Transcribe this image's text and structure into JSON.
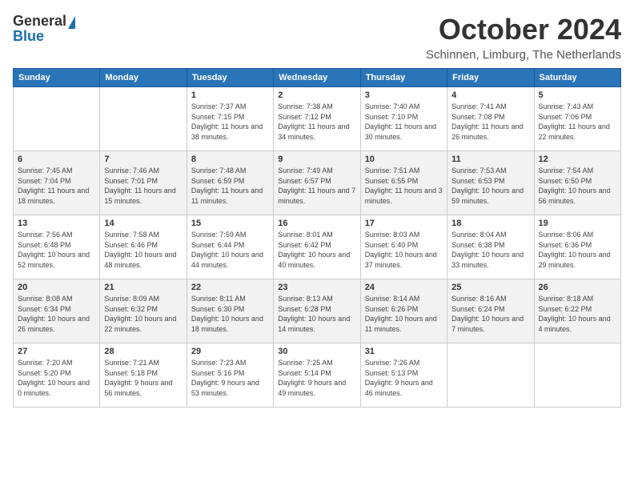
{
  "header": {
    "logo_general": "General",
    "logo_blue": "Blue",
    "month_title": "October 2024",
    "location": "Schinnen, Limburg, The Netherlands"
  },
  "days_of_week": [
    "Sunday",
    "Monday",
    "Tuesday",
    "Wednesday",
    "Thursday",
    "Friday",
    "Saturday"
  ],
  "weeks": [
    {
      "shaded": false,
      "days": [
        {
          "num": "",
          "info": ""
        },
        {
          "num": "",
          "info": ""
        },
        {
          "num": "1",
          "info": "Sunrise: 7:37 AM\nSunset: 7:15 PM\nDaylight: 11 hours and 38 minutes."
        },
        {
          "num": "2",
          "info": "Sunrise: 7:38 AM\nSunset: 7:12 PM\nDaylight: 11 hours and 34 minutes."
        },
        {
          "num": "3",
          "info": "Sunrise: 7:40 AM\nSunset: 7:10 PM\nDaylight: 11 hours and 30 minutes."
        },
        {
          "num": "4",
          "info": "Sunrise: 7:41 AM\nSunset: 7:08 PM\nDaylight: 11 hours and 26 minutes."
        },
        {
          "num": "5",
          "info": "Sunrise: 7:43 AM\nSunset: 7:06 PM\nDaylight: 11 hours and 22 minutes."
        }
      ]
    },
    {
      "shaded": true,
      "days": [
        {
          "num": "6",
          "info": "Sunrise: 7:45 AM\nSunset: 7:04 PM\nDaylight: 11 hours and 18 minutes."
        },
        {
          "num": "7",
          "info": "Sunrise: 7:46 AM\nSunset: 7:01 PM\nDaylight: 11 hours and 15 minutes."
        },
        {
          "num": "8",
          "info": "Sunrise: 7:48 AM\nSunset: 6:59 PM\nDaylight: 11 hours and 11 minutes."
        },
        {
          "num": "9",
          "info": "Sunrise: 7:49 AM\nSunset: 6:57 PM\nDaylight: 11 hours and 7 minutes."
        },
        {
          "num": "10",
          "info": "Sunrise: 7:51 AM\nSunset: 6:55 PM\nDaylight: 11 hours and 3 minutes."
        },
        {
          "num": "11",
          "info": "Sunrise: 7:53 AM\nSunset: 6:53 PM\nDaylight: 10 hours and 59 minutes."
        },
        {
          "num": "12",
          "info": "Sunrise: 7:54 AM\nSunset: 6:50 PM\nDaylight: 10 hours and 56 minutes."
        }
      ]
    },
    {
      "shaded": false,
      "days": [
        {
          "num": "13",
          "info": "Sunrise: 7:56 AM\nSunset: 6:48 PM\nDaylight: 10 hours and 52 minutes."
        },
        {
          "num": "14",
          "info": "Sunrise: 7:58 AM\nSunset: 6:46 PM\nDaylight: 10 hours and 48 minutes."
        },
        {
          "num": "15",
          "info": "Sunrise: 7:59 AM\nSunset: 6:44 PM\nDaylight: 10 hours and 44 minutes."
        },
        {
          "num": "16",
          "info": "Sunrise: 8:01 AM\nSunset: 6:42 PM\nDaylight: 10 hours and 40 minutes."
        },
        {
          "num": "17",
          "info": "Sunrise: 8:03 AM\nSunset: 6:40 PM\nDaylight: 10 hours and 37 minutes."
        },
        {
          "num": "18",
          "info": "Sunrise: 8:04 AM\nSunset: 6:38 PM\nDaylight: 10 hours and 33 minutes."
        },
        {
          "num": "19",
          "info": "Sunrise: 8:06 AM\nSunset: 6:36 PM\nDaylight: 10 hours and 29 minutes."
        }
      ]
    },
    {
      "shaded": true,
      "days": [
        {
          "num": "20",
          "info": "Sunrise: 8:08 AM\nSunset: 6:34 PM\nDaylight: 10 hours and 26 minutes."
        },
        {
          "num": "21",
          "info": "Sunrise: 8:09 AM\nSunset: 6:32 PM\nDaylight: 10 hours and 22 minutes."
        },
        {
          "num": "22",
          "info": "Sunrise: 8:11 AM\nSunset: 6:30 PM\nDaylight: 10 hours and 18 minutes."
        },
        {
          "num": "23",
          "info": "Sunrise: 8:13 AM\nSunset: 6:28 PM\nDaylight: 10 hours and 14 minutes."
        },
        {
          "num": "24",
          "info": "Sunrise: 8:14 AM\nSunset: 6:26 PM\nDaylight: 10 hours and 11 minutes."
        },
        {
          "num": "25",
          "info": "Sunrise: 8:16 AM\nSunset: 6:24 PM\nDaylight: 10 hours and 7 minutes."
        },
        {
          "num": "26",
          "info": "Sunrise: 8:18 AM\nSunset: 6:22 PM\nDaylight: 10 hours and 4 minutes."
        }
      ]
    },
    {
      "shaded": false,
      "days": [
        {
          "num": "27",
          "info": "Sunrise: 7:20 AM\nSunset: 5:20 PM\nDaylight: 10 hours and 0 minutes."
        },
        {
          "num": "28",
          "info": "Sunrise: 7:21 AM\nSunset: 5:18 PM\nDaylight: 9 hours and 56 minutes."
        },
        {
          "num": "29",
          "info": "Sunrise: 7:23 AM\nSunset: 5:16 PM\nDaylight: 9 hours and 53 minutes."
        },
        {
          "num": "30",
          "info": "Sunrise: 7:25 AM\nSunset: 5:14 PM\nDaylight: 9 hours and 49 minutes."
        },
        {
          "num": "31",
          "info": "Sunrise: 7:26 AM\nSunset: 5:13 PM\nDaylight: 9 hours and 46 minutes."
        },
        {
          "num": "",
          "info": ""
        },
        {
          "num": "",
          "info": ""
        }
      ]
    }
  ]
}
